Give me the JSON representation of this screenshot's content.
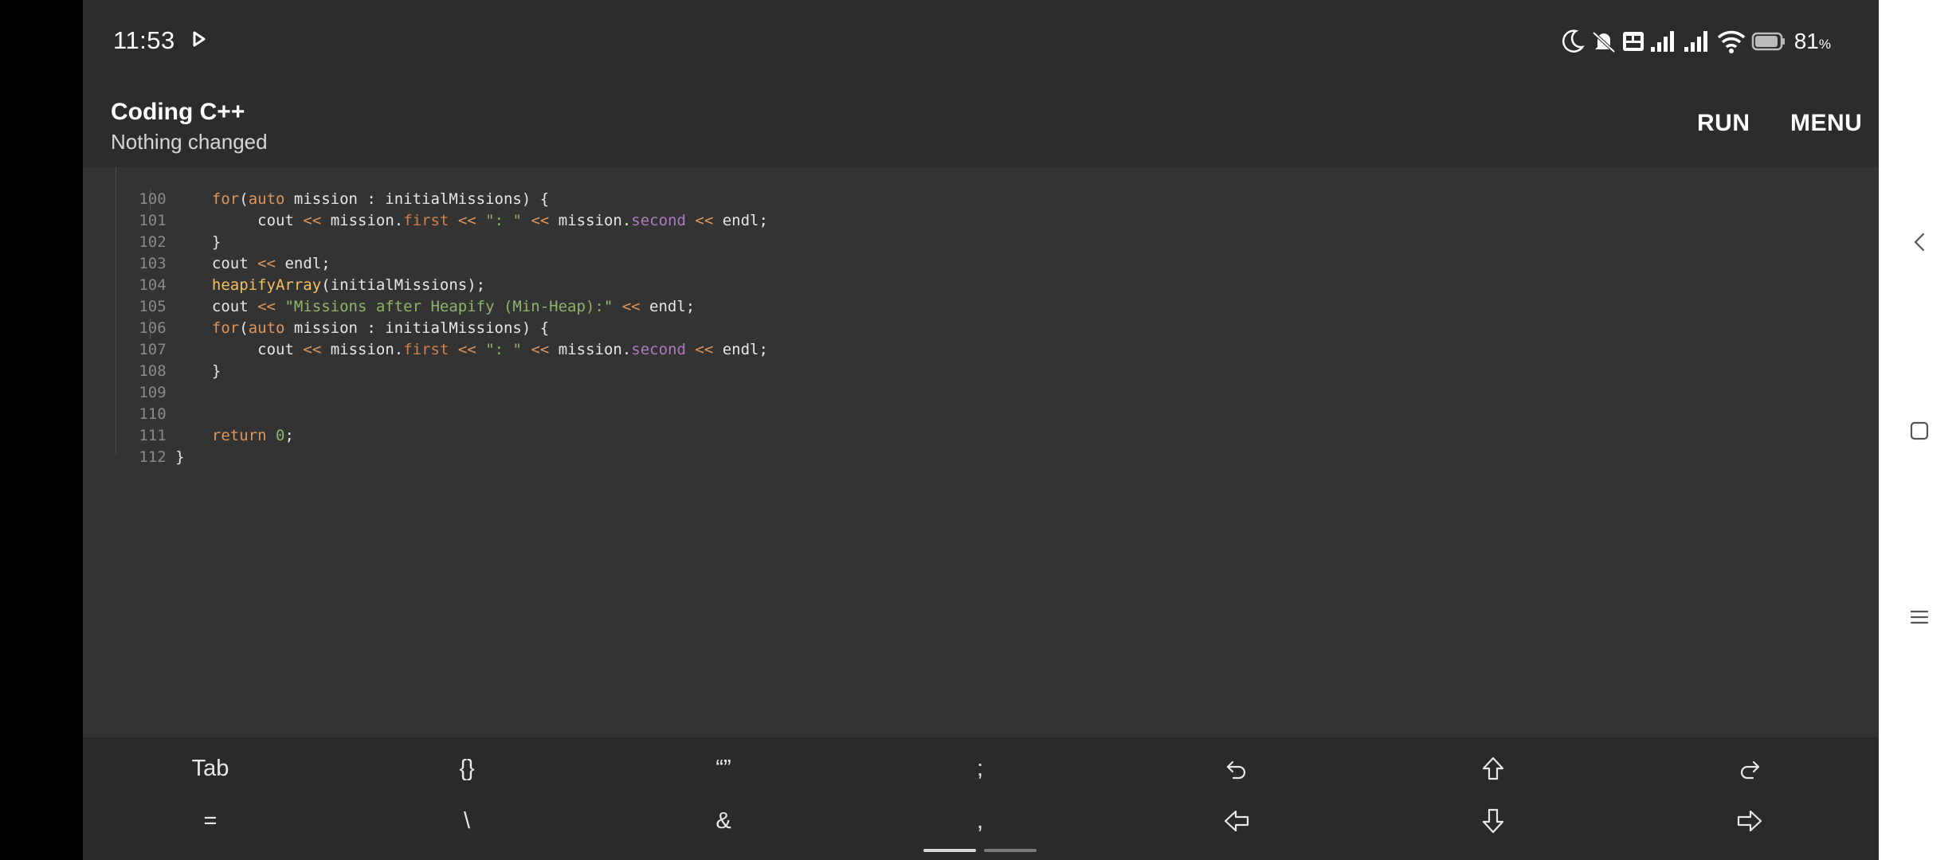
{
  "status_bar": {
    "time": "11:53",
    "battery_percent": "81",
    "battery_unit": "%",
    "icons": [
      "play-icon",
      "moon-icon",
      "mute-icon",
      "volte-icon",
      "signal-icon",
      "signal-icon",
      "wifi-icon",
      "battery-icon"
    ]
  },
  "app_bar": {
    "title": "Coding C++",
    "subtitle": "Nothing changed",
    "run_label": "RUN",
    "menu_label": "MENU"
  },
  "editor": {
    "lines": [
      {
        "num": "100",
        "code": "for(auto mission : initialMissions) {"
      },
      {
        "num": "101",
        "code": "cout << mission.first << \": \" << mission.second << endl;"
      },
      {
        "num": "102",
        "code": "}"
      },
      {
        "num": "103",
        "code": "cout << endl;"
      },
      {
        "num": "104",
        "code": "heapifyArray(initialMissions);"
      },
      {
        "num": "105",
        "code": "cout << \"Missions after Heapify (Min-Heap):\" << endl;"
      },
      {
        "num": "106",
        "code": "for(auto mission : initialMissions) {"
      },
      {
        "num": "107",
        "code": "cout << mission.first << \": \" << mission.second << endl;"
      },
      {
        "num": "108",
        "code": "}"
      },
      {
        "num": "109",
        "code": ""
      },
      {
        "num": "110",
        "code": ""
      },
      {
        "num": "111",
        "code": "return 0;"
      },
      {
        "num": "112",
        "code": "}"
      }
    ],
    "tokens": {
      "for": "for",
      "paren_open": "(",
      "auto": "auto",
      "mission": " mission : initialMissions) {",
      "cout": "cout ",
      "shift": "<<",
      "mission_dot": " mission.",
      "first": "first",
      "sep_str": "\": \"",
      "second": "second",
      "endl": " endl;",
      "endl_plain": "endl;",
      "brace_close": "}",
      "heapify_fn": "heapifyArray",
      "heapify_args": "(initialMissions);",
      "missions_str": "\"Missions after Heapify (Min-Heap):\"",
      "return_kw": "return",
      "zero": "0",
      "semicolon": ";",
      "space": " "
    }
  },
  "extra_keys": {
    "row1": [
      "Tab",
      "{}",
      "“”",
      ";",
      "undo-icon",
      "shift-up-icon",
      "redo-icon"
    ],
    "row2": [
      "=",
      "\\",
      "&",
      ",",
      "arrow-left-icon",
      "arrow-down-icon",
      "arrow-right-icon"
    ]
  },
  "side_panel": {
    "buttons": [
      "back-chevron-icon",
      "square-icon",
      "menu-lines-icon"
    ]
  }
}
